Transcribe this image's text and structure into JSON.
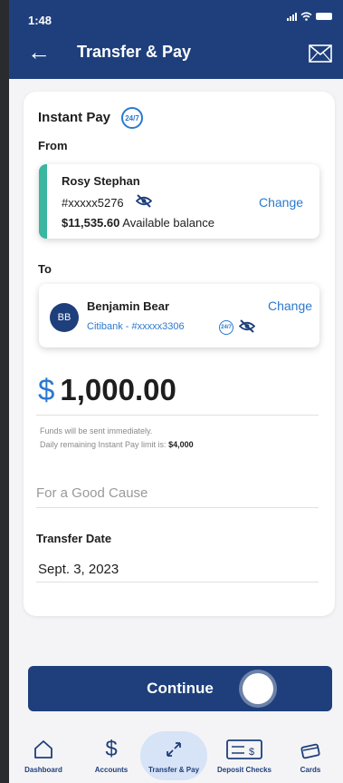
{
  "status": {
    "time": "1:48"
  },
  "header": {
    "title": "Transfer & Pay"
  },
  "instant_pay": {
    "title": "Instant Pay",
    "badge": "24/7"
  },
  "from": {
    "label": "From",
    "name": "Rosy Stephan",
    "account": "#xxxxx5276",
    "balance_amount": "$11,535.60",
    "balance_text": "Available balance",
    "change_label": "Change"
  },
  "to": {
    "label": "To",
    "initials": "BB",
    "name": "Benjamin Bear",
    "bank_account": "Citibank - #xxxxx3306",
    "badge": "24/7",
    "change_label": "Change"
  },
  "amount": {
    "currency": "$",
    "value": "1,000.00"
  },
  "notes": {
    "line1": "Funds will be sent immediately.",
    "line2": "Daily remaining Instant Pay limit is:",
    "limit": "$4,000"
  },
  "memo": {
    "placeholder": "For a Good Cause"
  },
  "transfer_date": {
    "label": "Transfer Date",
    "value": "Sept. 3, 2023"
  },
  "continue_label": "Continue",
  "tabs": [
    {
      "label": "Dashboard",
      "icon": "home-icon"
    },
    {
      "label": "Accounts",
      "icon": "dollar-icon"
    },
    {
      "label": "Transfer & Pay",
      "icon": "transfer-icon",
      "active": true
    },
    {
      "label": "Deposit Checks",
      "icon": "check-icon"
    },
    {
      "label": "Cards",
      "icon": "card-icon"
    }
  ],
  "colors": {
    "primary": "#1e3f7c",
    "accent": "#2a79cf",
    "teal": "#3bb6a0"
  }
}
